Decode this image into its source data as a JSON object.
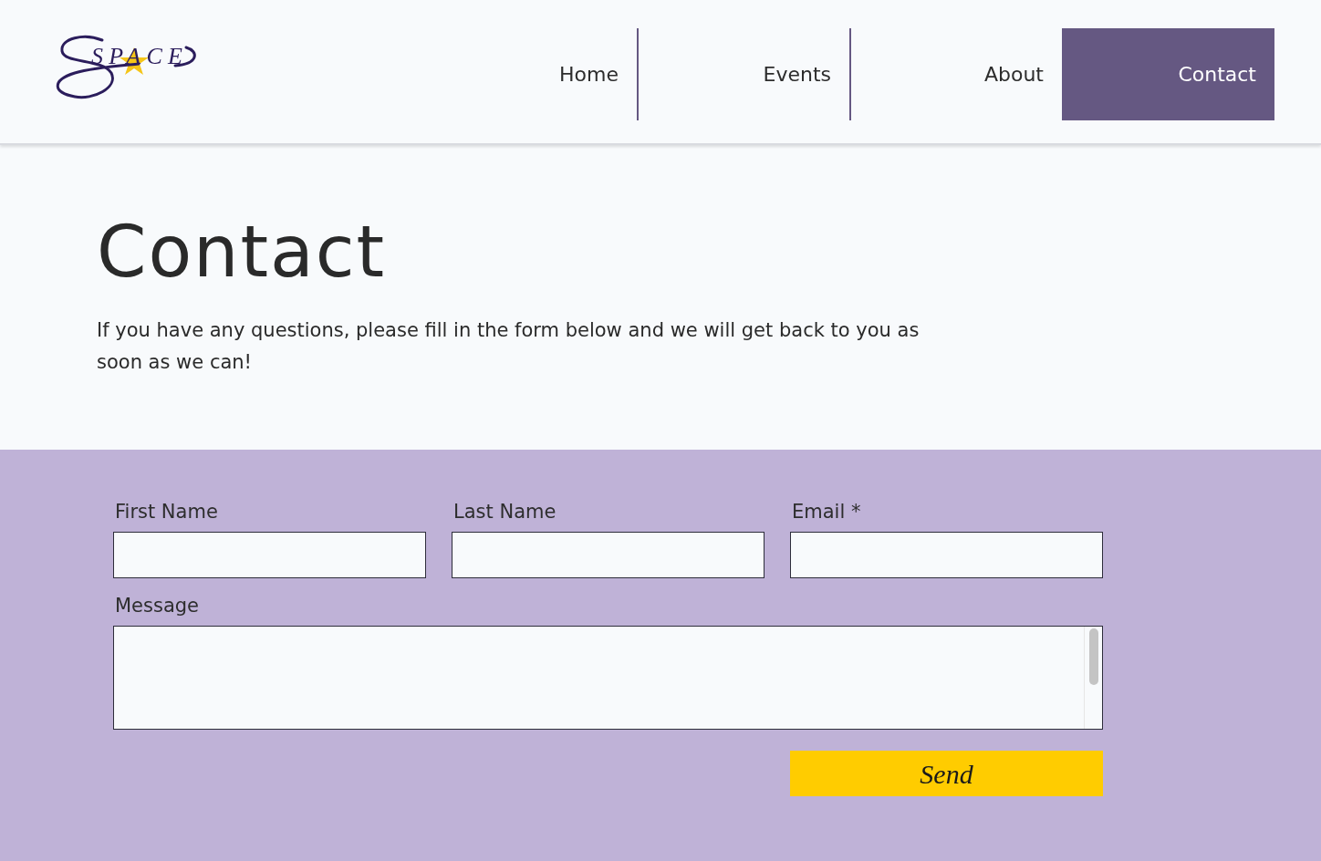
{
  "logo": {
    "text": "SPACE"
  },
  "nav": [
    {
      "label": "Home",
      "selected": false
    },
    {
      "label": "Events",
      "selected": false
    },
    {
      "label": "About",
      "selected": false
    },
    {
      "label": "Contact",
      "selected": true
    }
  ],
  "page": {
    "title": "Contact",
    "intro": "If you have any questions, please fill in the form below and we will get back to you as soon as we can!"
  },
  "form": {
    "fields": [
      {
        "label": "First Name"
      },
      {
        "label": "Last Name"
      },
      {
        "label": "Email *"
      }
    ],
    "message": {
      "label": "Message"
    },
    "submit": "Send"
  }
}
